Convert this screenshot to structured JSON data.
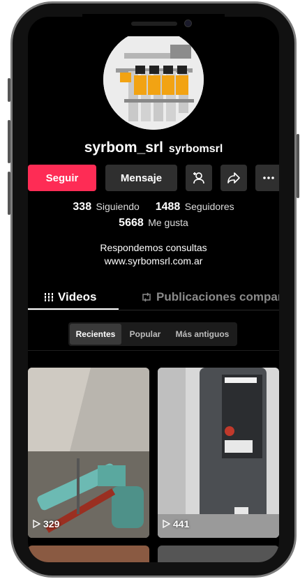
{
  "profile": {
    "username": "syrbom_srl",
    "handle": "syrbomsrl",
    "bio_line1": "Respondemos consultas",
    "bio_line2": "www.syrbomsrl.com.ar"
  },
  "actions": {
    "follow_label": "Seguir",
    "message_label": "Mensaje",
    "add_friend_icon": "person-plus-icon",
    "share_icon": "share-arrow-icon",
    "more_icon": "more-dots-icon"
  },
  "stats": {
    "following_count": "338",
    "following_label": "Siguiendo",
    "followers_count": "1488",
    "followers_label": "Seguidores",
    "likes_count": "5668",
    "likes_label": "Me gusta"
  },
  "tabs": {
    "videos_label": "Videos",
    "reposts_label": "Publicaciones compartidas"
  },
  "sort": {
    "recent": "Recientes",
    "popular": "Popular",
    "oldest": "Más antiguos"
  },
  "videos": [
    {
      "views": "329"
    },
    {
      "views": "441"
    }
  ],
  "colors": {
    "accent": "#fe2c55",
    "background": "#000000"
  }
}
